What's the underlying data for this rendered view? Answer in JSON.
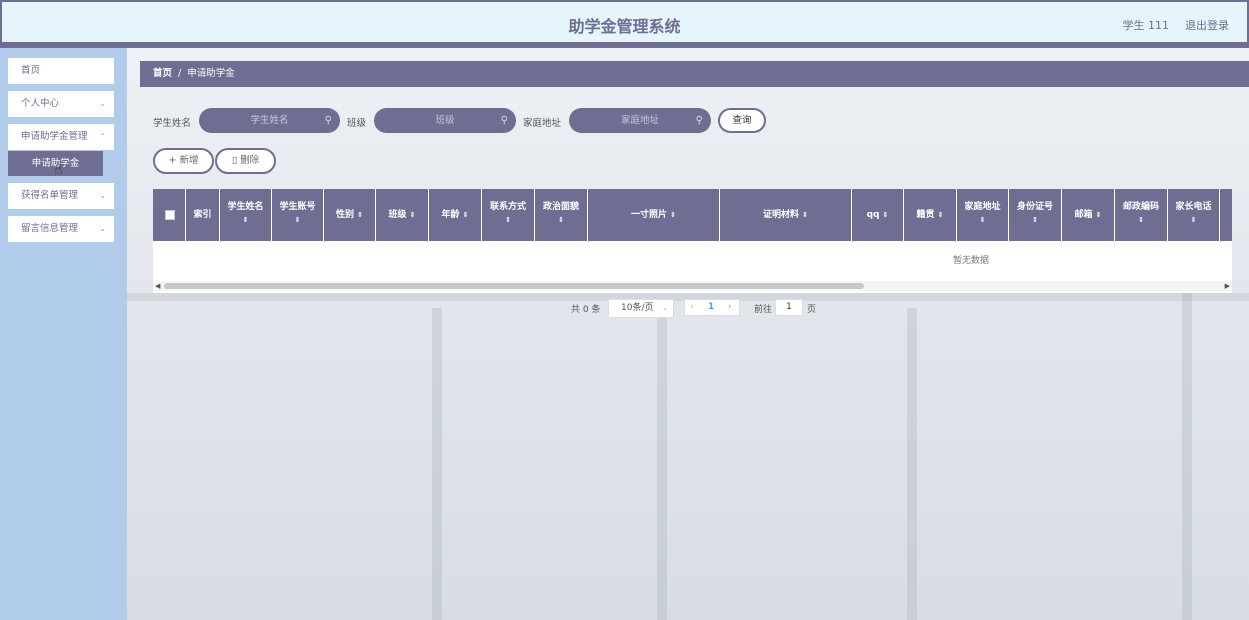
{
  "header": {
    "title": "助学金管理系统",
    "user": "学生 111",
    "logout": "退出登录"
  },
  "sidebar": {
    "items": [
      {
        "label": "首页",
        "has_children": false
      },
      {
        "label": "个人中心",
        "has_children": true
      },
      {
        "label": "申请助学金管理",
        "has_children": true
      },
      {
        "label": "获得名单管理",
        "has_children": true
      },
      {
        "label": "留言信息管理",
        "has_children": true
      }
    ],
    "active_sub": "申请助学金"
  },
  "breadcrumb": {
    "home": "首页",
    "separator": "/",
    "current": "申请助学金"
  },
  "search": {
    "fields": [
      {
        "label": "学生姓名",
        "placeholder": "学生姓名"
      },
      {
        "label": "班级",
        "placeholder": "班级"
      },
      {
        "label": "家庭地址",
        "placeholder": "家庭地址"
      }
    ],
    "query_button": "查询"
  },
  "actions": {
    "add": "新增",
    "delete": "删除"
  },
  "table": {
    "columns": [
      "索引",
      "学生姓名",
      "学生账号",
      "性别",
      "班级",
      "年龄",
      "联系方式",
      "政治面貌",
      "一寸照片",
      "证明材料",
      "qq",
      "籍贯",
      "家庭地址",
      "身份证号",
      "邮箱",
      "邮政编码",
      "家长电话",
      "家"
    ],
    "empty_text": "暂无数据"
  },
  "pagination": {
    "total": "共 0 条",
    "page_size": "10条/页",
    "current_page": "1",
    "goto_label": "前往",
    "goto_value": "1",
    "page_suffix": "页"
  },
  "colors": {
    "accent": "#6d6e92",
    "header_bg": "#e6f4fb",
    "sidebar_bg": "#b0ccea"
  }
}
